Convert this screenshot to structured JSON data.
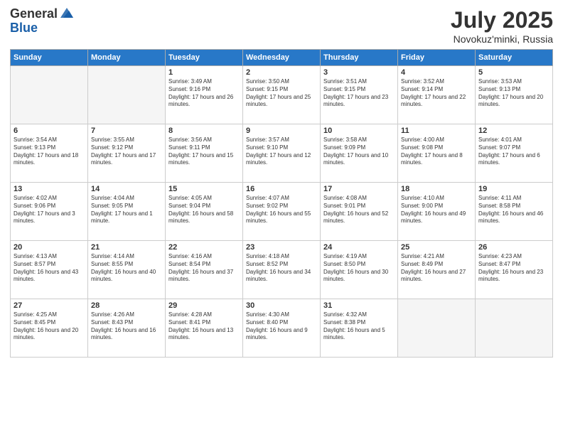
{
  "header": {
    "logo_general": "General",
    "logo_blue": "Blue",
    "title": "July 2025",
    "location": "Novokuz'minki, Russia"
  },
  "days_of_week": [
    "Sunday",
    "Monday",
    "Tuesday",
    "Wednesday",
    "Thursday",
    "Friday",
    "Saturday"
  ],
  "weeks": [
    [
      {
        "day": "",
        "info": ""
      },
      {
        "day": "",
        "info": ""
      },
      {
        "day": "1",
        "info": "Sunrise: 3:49 AM\nSunset: 9:16 PM\nDaylight: 17 hours and 26 minutes."
      },
      {
        "day": "2",
        "info": "Sunrise: 3:50 AM\nSunset: 9:15 PM\nDaylight: 17 hours and 25 minutes."
      },
      {
        "day": "3",
        "info": "Sunrise: 3:51 AM\nSunset: 9:15 PM\nDaylight: 17 hours and 23 minutes."
      },
      {
        "day": "4",
        "info": "Sunrise: 3:52 AM\nSunset: 9:14 PM\nDaylight: 17 hours and 22 minutes."
      },
      {
        "day": "5",
        "info": "Sunrise: 3:53 AM\nSunset: 9:13 PM\nDaylight: 17 hours and 20 minutes."
      }
    ],
    [
      {
        "day": "6",
        "info": "Sunrise: 3:54 AM\nSunset: 9:13 PM\nDaylight: 17 hours and 18 minutes."
      },
      {
        "day": "7",
        "info": "Sunrise: 3:55 AM\nSunset: 9:12 PM\nDaylight: 17 hours and 17 minutes."
      },
      {
        "day": "8",
        "info": "Sunrise: 3:56 AM\nSunset: 9:11 PM\nDaylight: 17 hours and 15 minutes."
      },
      {
        "day": "9",
        "info": "Sunrise: 3:57 AM\nSunset: 9:10 PM\nDaylight: 17 hours and 12 minutes."
      },
      {
        "day": "10",
        "info": "Sunrise: 3:58 AM\nSunset: 9:09 PM\nDaylight: 17 hours and 10 minutes."
      },
      {
        "day": "11",
        "info": "Sunrise: 4:00 AM\nSunset: 9:08 PM\nDaylight: 17 hours and 8 minutes."
      },
      {
        "day": "12",
        "info": "Sunrise: 4:01 AM\nSunset: 9:07 PM\nDaylight: 17 hours and 6 minutes."
      }
    ],
    [
      {
        "day": "13",
        "info": "Sunrise: 4:02 AM\nSunset: 9:06 PM\nDaylight: 17 hours and 3 minutes."
      },
      {
        "day": "14",
        "info": "Sunrise: 4:04 AM\nSunset: 9:05 PM\nDaylight: 17 hours and 1 minute."
      },
      {
        "day": "15",
        "info": "Sunrise: 4:05 AM\nSunset: 9:04 PM\nDaylight: 16 hours and 58 minutes."
      },
      {
        "day": "16",
        "info": "Sunrise: 4:07 AM\nSunset: 9:02 PM\nDaylight: 16 hours and 55 minutes."
      },
      {
        "day": "17",
        "info": "Sunrise: 4:08 AM\nSunset: 9:01 PM\nDaylight: 16 hours and 52 minutes."
      },
      {
        "day": "18",
        "info": "Sunrise: 4:10 AM\nSunset: 9:00 PM\nDaylight: 16 hours and 49 minutes."
      },
      {
        "day": "19",
        "info": "Sunrise: 4:11 AM\nSunset: 8:58 PM\nDaylight: 16 hours and 46 minutes."
      }
    ],
    [
      {
        "day": "20",
        "info": "Sunrise: 4:13 AM\nSunset: 8:57 PM\nDaylight: 16 hours and 43 minutes."
      },
      {
        "day": "21",
        "info": "Sunrise: 4:14 AM\nSunset: 8:55 PM\nDaylight: 16 hours and 40 minutes."
      },
      {
        "day": "22",
        "info": "Sunrise: 4:16 AM\nSunset: 8:54 PM\nDaylight: 16 hours and 37 minutes."
      },
      {
        "day": "23",
        "info": "Sunrise: 4:18 AM\nSunset: 8:52 PM\nDaylight: 16 hours and 34 minutes."
      },
      {
        "day": "24",
        "info": "Sunrise: 4:19 AM\nSunset: 8:50 PM\nDaylight: 16 hours and 30 minutes."
      },
      {
        "day": "25",
        "info": "Sunrise: 4:21 AM\nSunset: 8:49 PM\nDaylight: 16 hours and 27 minutes."
      },
      {
        "day": "26",
        "info": "Sunrise: 4:23 AM\nSunset: 8:47 PM\nDaylight: 16 hours and 23 minutes."
      }
    ],
    [
      {
        "day": "27",
        "info": "Sunrise: 4:25 AM\nSunset: 8:45 PM\nDaylight: 16 hours and 20 minutes."
      },
      {
        "day": "28",
        "info": "Sunrise: 4:26 AM\nSunset: 8:43 PM\nDaylight: 16 hours and 16 minutes."
      },
      {
        "day": "29",
        "info": "Sunrise: 4:28 AM\nSunset: 8:41 PM\nDaylight: 16 hours and 13 minutes."
      },
      {
        "day": "30",
        "info": "Sunrise: 4:30 AM\nSunset: 8:40 PM\nDaylight: 16 hours and 9 minutes."
      },
      {
        "day": "31",
        "info": "Sunrise: 4:32 AM\nSunset: 8:38 PM\nDaylight: 16 hours and 5 minutes."
      },
      {
        "day": "",
        "info": ""
      },
      {
        "day": "",
        "info": ""
      }
    ]
  ]
}
